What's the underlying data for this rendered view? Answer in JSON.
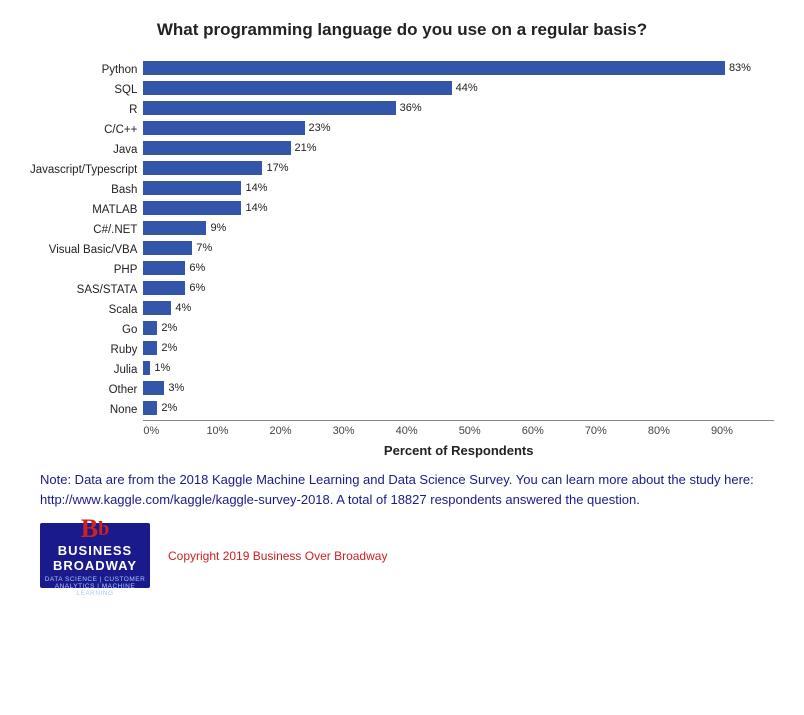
{
  "chart": {
    "title": "What programming language do you use on a regular basis?",
    "bars": [
      {
        "label": "Python",
        "value": 83,
        "display": "83%"
      },
      {
        "label": "SQL",
        "value": 44,
        "display": "44%"
      },
      {
        "label": "R",
        "value": 36,
        "display": "36%"
      },
      {
        "label": "C/C++",
        "value": 23,
        "display": "23%"
      },
      {
        "label": "Java",
        "value": 21,
        "display": "21%"
      },
      {
        "label": "Javascript/Typescript",
        "value": 17,
        "display": "17%"
      },
      {
        "label": "Bash",
        "value": 14,
        "display": "14%"
      },
      {
        "label": "MATLAB",
        "value": 14,
        "display": "14%"
      },
      {
        "label": "C#/.NET",
        "value": 9,
        "display": "9%"
      },
      {
        "label": "Visual Basic/VBA",
        "value": 7,
        "display": "7%"
      },
      {
        "label": "PHP",
        "value": 6,
        "display": "6%"
      },
      {
        "label": "SAS/STATA",
        "value": 6,
        "display": "6%"
      },
      {
        "label": "Scala",
        "value": 4,
        "display": "4%"
      },
      {
        "label": "Go",
        "value": 2,
        "display": "2%"
      },
      {
        "label": "Ruby",
        "value": 2,
        "display": "2%"
      },
      {
        "label": "Julia",
        "value": 1,
        "display": "1%"
      },
      {
        "label": "Other",
        "value": 3,
        "display": "3%"
      },
      {
        "label": "None",
        "value": 2,
        "display": "2%"
      }
    ],
    "x_axis": {
      "title": "Percent of Respondents",
      "ticks": [
        "0%",
        "10%",
        "20%",
        "30%",
        "40%",
        "50%",
        "60%",
        "70%",
        "80%",
        "90%"
      ],
      "max": 90
    }
  },
  "note": {
    "text": "Note: Data are from the 2018 Kaggle Machine Learning and Data Science Survey. You can learn more about the study here: http://www.kaggle.com/kaggle/kaggle-survey-2018.  A total of 18827 respondents answered the question."
  },
  "footer": {
    "logo": {
      "letters": "Bb",
      "name": "BUSINESS\nBROADWAY",
      "tagline": "DATA SCIENCE  |  CUSTOMER ANALYTICS  |  MACHINE LEARNING"
    },
    "copyright": "Copyright 2019 Business Over Broadway"
  }
}
